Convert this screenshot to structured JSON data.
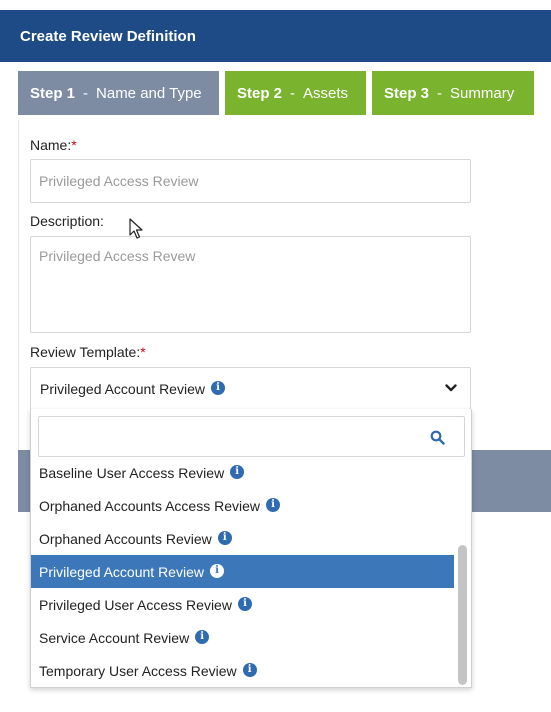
{
  "header": {
    "title": "Create Review Definition"
  },
  "tabs": [
    {
      "step": "Step 1",
      "label": "Name and Type",
      "active": true
    },
    {
      "step": "Step 2",
      "label": "Assets",
      "active": false
    },
    {
      "step": "Step 3",
      "label": "Summary",
      "active": false
    }
  ],
  "form": {
    "name_label": "Name:",
    "required_mark": "*",
    "name_placeholder": "Privileged Access Review",
    "description_label": "Description:",
    "description_placeholder": "Privileged Access Revew",
    "template_label": "Review Template:",
    "template_selected": "Privileged Account Review"
  },
  "dropdown": {
    "search_value": "",
    "options": [
      {
        "label": "Baseline User Access Review",
        "selected": false
      },
      {
        "label": "Orphaned Accounts Access Review",
        "selected": false
      },
      {
        "label": "Orphaned Accounts Review",
        "selected": false
      },
      {
        "label": "Privileged Account Review",
        "selected": true
      },
      {
        "label": "Privileged User Access Review",
        "selected": false
      },
      {
        "label": "Service Account Review",
        "selected": false
      },
      {
        "label": "Temporary User Access Review",
        "selected": false
      }
    ]
  },
  "icons": {
    "info": "info-circle-icon",
    "chevron": "chevron-down-icon",
    "search": "search-icon",
    "cursor": "mouse-pointer-icon",
    "info_glyph": "i"
  },
  "colors": {
    "header_bg": "#1e4b86",
    "tab_active_bg": "#7d8ca3",
    "tab_inactive_bg": "#7ab32e",
    "selected_option_bg": "#3c78b9",
    "info_icon": "#2f6bb0",
    "required": "#d0021b"
  }
}
